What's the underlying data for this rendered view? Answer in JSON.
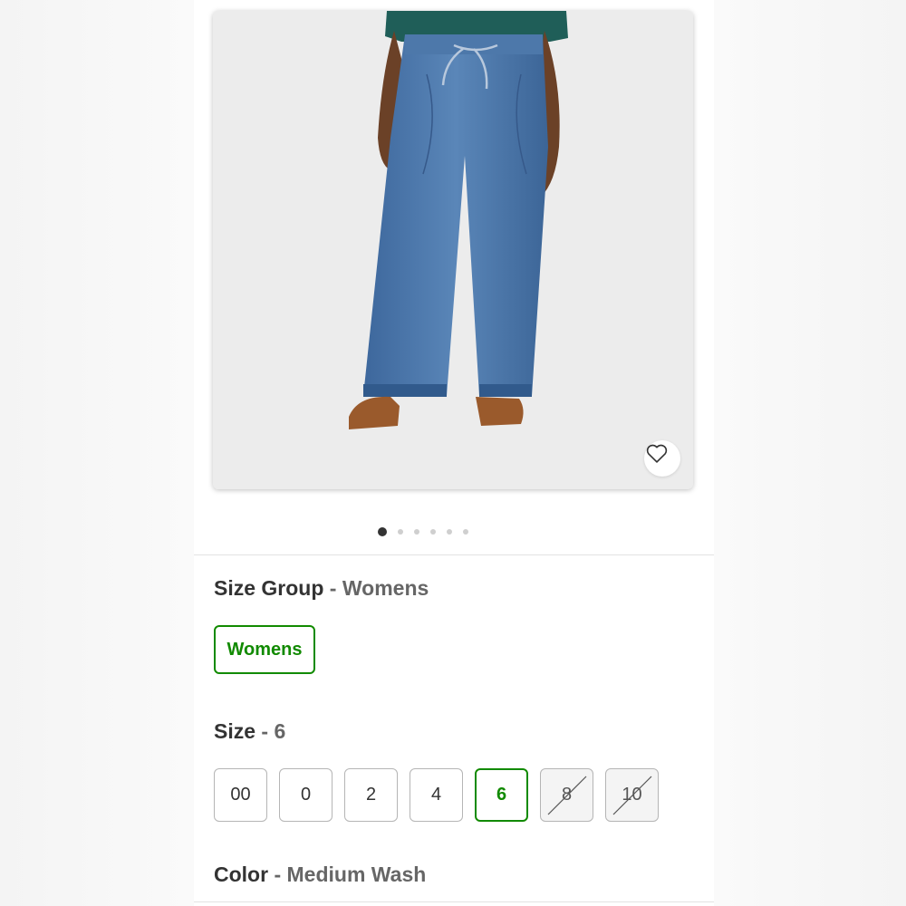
{
  "product_image": {
    "alt_icon": "jeans-photo",
    "favorite_icon": "heart-outline-icon"
  },
  "carousel": {
    "total": 6,
    "active_index": 0
  },
  "size_group": {
    "label": "Size Group",
    "separator": " - ",
    "selected": "Womens",
    "options": [
      "Womens"
    ]
  },
  "size": {
    "label": "Size",
    "separator": " - ",
    "selected": "6",
    "options": [
      {
        "label": "00",
        "state": "available"
      },
      {
        "label": "0",
        "state": "available"
      },
      {
        "label": "2",
        "state": "available"
      },
      {
        "label": "4",
        "state": "available"
      },
      {
        "label": "6",
        "state": "selected"
      },
      {
        "label": "8",
        "state": "unavailable"
      },
      {
        "label": "10",
        "state": "unavailable"
      }
    ]
  },
  "color": {
    "label": "Color",
    "separator": " - ",
    "selected": "Medium Wash"
  },
  "colors": {
    "accent": "#118a00",
    "text": "#333333",
    "muted": "#666666"
  }
}
